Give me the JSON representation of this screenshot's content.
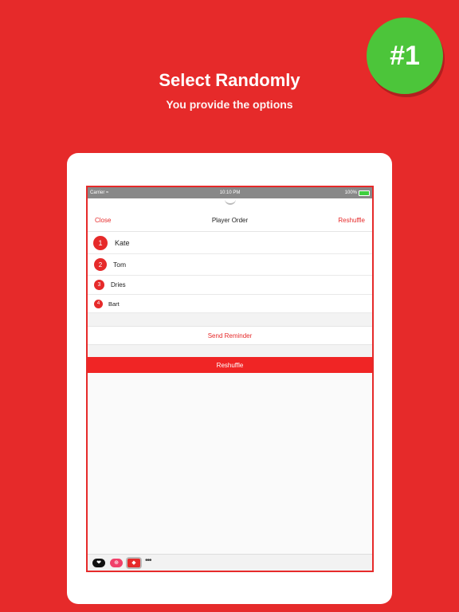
{
  "promo": {
    "headline": "Select Randomly",
    "subline": "You provide the options",
    "badge": "#1"
  },
  "statusbar": {
    "carrier": "Carrier",
    "time": "10:10 PM",
    "battery": "100%"
  },
  "navbar": {
    "close": "Close",
    "title": "Player Order",
    "reshuffle": "Reshuffle"
  },
  "players": [
    {
      "number": "1",
      "name": "Kate"
    },
    {
      "number": "2",
      "name": "Tom"
    },
    {
      "number": "3",
      "name": "Dries"
    },
    {
      "number": "4",
      "name": "Bart"
    }
  ],
  "actions": {
    "send_reminder": "Send Reminder",
    "reshuffle": "Reshuffle"
  },
  "tray": {
    "more": "•••",
    "icons": [
      "heart-app-icon",
      "search-app-icon",
      "dice-app-icon"
    ]
  },
  "colors": {
    "accent": "#e62a2a",
    "badge": "#4cc53a"
  }
}
